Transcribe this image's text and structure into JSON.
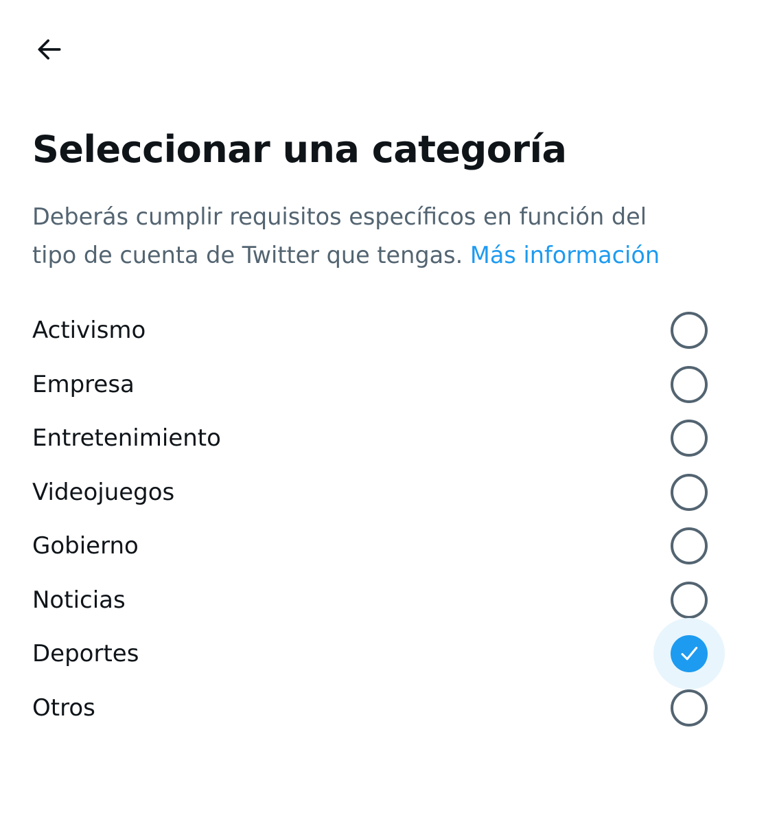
{
  "header": {
    "back_icon": "arrow-left-icon"
  },
  "title": "Seleccionar una categoría",
  "description": {
    "line1": "Deberás cumplir requisitos específicos en función del",
    "line2": "tipo de cuenta de Twitter que tengas.",
    "link": "Más información"
  },
  "options": [
    {
      "label": "Activismo",
      "selected": false
    },
    {
      "label": "Empresa",
      "selected": false
    },
    {
      "label": "Entretenimiento",
      "selected": false
    },
    {
      "label": "Videojuegos",
      "selected": false
    },
    {
      "label": "Gobierno",
      "selected": false
    },
    {
      "label": "Noticias",
      "selected": false
    },
    {
      "label": "Deportes",
      "selected": true
    },
    {
      "label": "Otros",
      "selected": false
    }
  ],
  "colors": {
    "accent": "#1d9bf0",
    "selected_halo": "#e8f5fd",
    "text_primary": "#0f1419",
    "text_secondary": "#536471"
  },
  "icons": {
    "radio_unchecked": "radio-empty-icon",
    "radio_checked": "checkmark-icon"
  }
}
